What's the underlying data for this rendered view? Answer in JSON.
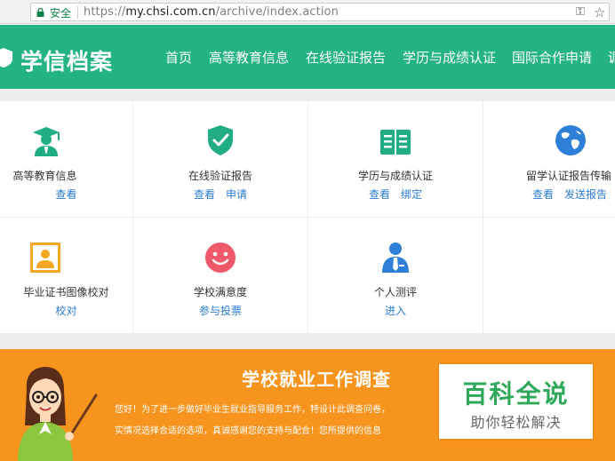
{
  "browser": {
    "secure_label": "安全",
    "url_scheme": "https://",
    "url_host": "my.chsi.com.cn",
    "url_path": "/archive/index.action"
  },
  "header": {
    "logo_text": "学信档案",
    "nav": [
      "首页",
      "高等教育信息",
      "在线验证报告",
      "学历与成绩认证",
      "国际合作申请",
      "调"
    ]
  },
  "grid": {
    "cells": [
      {
        "title": "高等教育信息",
        "links": [
          "查看"
        ],
        "icon": "graduate-icon",
        "color": "#22ac84"
      },
      {
        "title": "在线验证报告",
        "links": [
          "查看",
          "申请"
        ],
        "icon": "shield-check-icon",
        "color": "#22ac84"
      },
      {
        "title": "学历与成绩认证",
        "links": [
          "查看",
          "绑定"
        ],
        "icon": "book-icon",
        "color": "#22ac84"
      },
      {
        "title": "留学认证报告传输",
        "links": [
          "查看",
          "发送报告"
        ],
        "icon": "globe-icon",
        "color": "#2e7fd8"
      },
      {
        "title": "毕业证书图像校对",
        "links": [
          "校对"
        ],
        "icon": "portrait-icon",
        "color": "#f5a623"
      },
      {
        "title": "学校满意度",
        "links": [
          "参与投票"
        ],
        "icon": "smiley-icon",
        "color": "#ef5a6a"
      },
      {
        "title": "个人测评",
        "links": [
          "进入"
        ],
        "icon": "person-tie-icon",
        "color": "#2e7fd8"
      }
    ]
  },
  "banner": {
    "title": "学校就业工作调查",
    "line1": "您好！为了进一步做好毕业生就业指导服务工作，特设计此调查问卷，",
    "line2": "实情况选择合适的选项，真诚感谢您的支持与配合！您所提供的信息"
  },
  "watermark": {
    "main": "百科全说",
    "sub": "助你轻松解决"
  },
  "colors": {
    "header": "#24b383",
    "banner": "#f7941d",
    "link": "#2b7cd3"
  }
}
